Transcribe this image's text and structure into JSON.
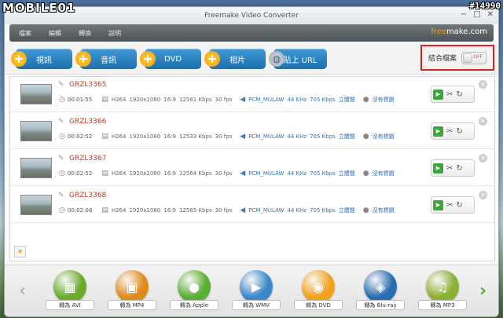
{
  "watermark": {
    "logo": "MOBILE01",
    "id": "#14990"
  },
  "window": {
    "title": "Freemake Video Converter",
    "controls": [
      "−",
      "□",
      "✕"
    ]
  },
  "menu": {
    "items": [
      "檔案",
      "編輯",
      "轉換",
      "說明"
    ],
    "brand_a": "free",
    "brand_b": "make.com"
  },
  "toolbar": {
    "buttons": [
      "視訊",
      "音訊",
      "DVD",
      "相片",
      "貼上 URL"
    ],
    "merge_label": "結合檔案",
    "toggle_state": "OFF"
  },
  "files": [
    {
      "name": "GRZL3365",
      "duration": "00:01:55",
      "video": [
        "H264",
        "1920x1080",
        "16:9",
        "12561 Kbps",
        "30 fps"
      ],
      "audio": [
        "PCM_MULAW",
        "44 KHz",
        "705 Kbps",
        "立體聲"
      ],
      "subtitle": "沒有標題"
    },
    {
      "name": "GRZL3366",
      "duration": "00:02:52",
      "video": [
        "H264",
        "1920x1080",
        "16:9",
        "12533 Kbps",
        "30 fps"
      ],
      "audio": [
        "PCM_MULAW",
        "44 KHz",
        "705 Kbps",
        "立體聲"
      ],
      "subtitle": "沒有標題"
    },
    {
      "name": "GRZL3367",
      "duration": "00:02:52",
      "video": [
        "H264",
        "1920x1080",
        "16:9",
        "12564 Kbps",
        "30 fps"
      ],
      "audio": [
        "PCM_MULAW",
        "44 KHz",
        "705 Kbps",
        "立體聲"
      ],
      "subtitle": "沒有標題"
    },
    {
      "name": "GRZL3368",
      "duration": "00:02:08",
      "video": [
        "H264",
        "1920x1080",
        "16:9",
        "12565 Kbps",
        "30 fps"
      ],
      "audio": [
        "PCM_MULAW",
        "44 KHz",
        "705 Kbps",
        "立體聲"
      ],
      "subtitle": "沒有標題"
    }
  ],
  "converters": [
    {
      "label": "轉為 AVI",
      "icon": "film-icon",
      "color": "#6aaa2a"
    },
    {
      "label": "轉為 MP4",
      "icon": "mp4-icon",
      "color": "#e08a1a"
    },
    {
      "label": "轉為 Apple",
      "icon": "apple-icon",
      "color": "#58b030"
    },
    {
      "label": "轉為 WMV",
      "icon": "wmv-icon",
      "color": "#3a88c8"
    },
    {
      "label": "轉為 DVD",
      "icon": "dvd-icon",
      "color": "#f0a21a"
    },
    {
      "label": "轉為 Blu-ray",
      "icon": "bluray-icon",
      "color": "#2a6cb0"
    },
    {
      "label": "轉為 MP3",
      "icon": "headphones-icon",
      "color": "#8ab030"
    }
  ]
}
